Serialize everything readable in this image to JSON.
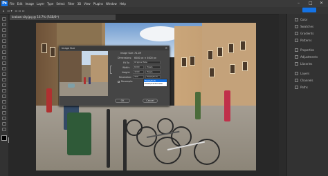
{
  "menubar": {
    "items": [
      "File",
      "Edit",
      "Image",
      "Layer",
      "Type",
      "Select",
      "Filter",
      "3D",
      "View",
      "Plugins",
      "Window",
      "Help"
    ],
    "window_controls": [
      "–",
      "□",
      "✕"
    ]
  },
  "document_tab": {
    "label": "krakow-city.jpg @ 16.7% (RGB/8*)"
  },
  "dialog": {
    "title": "Image Size",
    "close": "✕",
    "image_size_label": "Image Size:",
    "image_size_value": "70.1M",
    "dimensions_label": "Dimensions:",
    "dimensions_value": "6000 px × 4000 px",
    "fit_to_label": "Fit To:",
    "fit_to_value": "Original Size",
    "width_label": "Width:",
    "width_value": "6000",
    "width_unit": "Pixels",
    "height_label": "Height:",
    "height_value": "4000",
    "height_unit": "Pixels",
    "resolution_label": "Resolution:",
    "resolution_value": "300",
    "resolution_unit": "Pixels/Inch",
    "resample_label": "Resample:",
    "resample_options": [
      "Pixels/Inch",
      "Pixels/Centimeter"
    ],
    "ok_label": "OK",
    "cancel_label": "Cancel"
  },
  "right_panel": {
    "items": [
      "Color",
      "Swatches",
      "Gradients",
      "Patterns",
      "Properties",
      "Adjustments",
      "Libraries",
      "Layers",
      "Channels",
      "Paths"
    ]
  },
  "colors": {
    "accent": "#1473e6",
    "bg": "#282828"
  }
}
